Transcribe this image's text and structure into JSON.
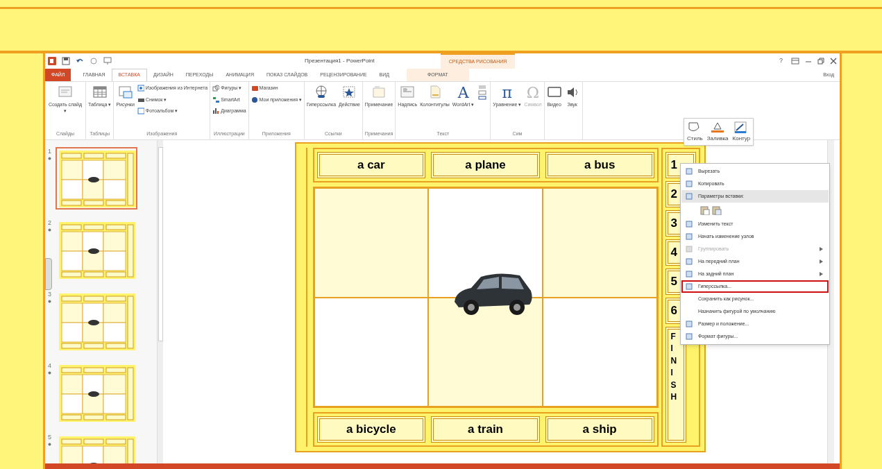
{
  "window": {
    "title": "Презентация1 - PowerPoint",
    "context_group": "СРЕДСТВА РИСОВАНИЯ",
    "help": "?",
    "sign_in": "Вход"
  },
  "tabs": [
    {
      "label": "ФАЙЛ",
      "kind": "file",
      "selected": false
    },
    {
      "label": "ГЛАВНАЯ",
      "kind": "tab",
      "selected": false
    },
    {
      "label": "ВСТАВКА",
      "kind": "tab",
      "selected": true
    },
    {
      "label": "ДИЗАЙН",
      "kind": "tab",
      "selected": false
    },
    {
      "label": "ПЕРЕХОДЫ",
      "kind": "tab",
      "selected": false
    },
    {
      "label": "АНИМАЦИЯ",
      "kind": "tab",
      "selected": false
    },
    {
      "label": "ПОКАЗ СЛАЙДОВ",
      "kind": "tab",
      "selected": false
    },
    {
      "label": "РЕЦЕНЗИРОВАНИЕ",
      "kind": "tab",
      "selected": false
    },
    {
      "label": "ВИД",
      "kind": "tab",
      "selected": false
    },
    {
      "label": "ФОРМАТ",
      "kind": "context",
      "selected": false
    }
  ],
  "ribbon_groups": [
    {
      "label": "Слайды",
      "items": [
        {
          "kind": "large",
          "label": "Создать слайд ▾",
          "disabled": false
        }
      ]
    },
    {
      "label": "Таблицы",
      "items": [
        {
          "kind": "large",
          "label": "Таблица ▾",
          "disabled": false
        }
      ]
    },
    {
      "label": "Изображения",
      "items": [
        {
          "kind": "large",
          "label": "Рисунки",
          "disabled": false
        },
        {
          "kind": "small",
          "label": "Изображения из Интернета",
          "disabled": false
        },
        {
          "kind": "small",
          "label": "Снимок ▾",
          "disabled": false
        },
        {
          "kind": "small",
          "label": "Фотоальбом ▾",
          "disabled": false
        }
      ]
    },
    {
      "label": "Иллюстрации",
      "items": [
        {
          "kind": "small",
          "label": "Фигуры ▾",
          "disabled": false
        },
        {
          "kind": "small",
          "label": "SmartArt",
          "disabled": false
        },
        {
          "kind": "small",
          "label": "Диаграмма",
          "disabled": false
        }
      ]
    },
    {
      "label": "Приложения",
      "items": [
        {
          "kind": "small",
          "label": "Магазин",
          "disabled": false
        },
        {
          "kind": "small",
          "label": "Мои приложения ▾",
          "disabled": false
        }
      ]
    },
    {
      "label": "Ссылки",
      "items": [
        {
          "kind": "large",
          "label": "Гиперссылка",
          "disabled": false
        },
        {
          "kind": "large",
          "label": "Действие",
          "disabled": false
        }
      ]
    },
    {
      "label": "Примечания",
      "items": [
        {
          "kind": "large",
          "label": "Примечание",
          "disabled": false
        }
      ]
    },
    {
      "label": "Текст",
      "items": [
        {
          "kind": "large",
          "label": "Надпись",
          "disabled": false
        },
        {
          "kind": "large",
          "label": "Колонтитулы",
          "disabled": false
        },
        {
          "kind": "large",
          "label": "WordArt ▾",
          "glyph": "A",
          "disabled": false
        },
        {
          "kind": "icons"
        }
      ]
    },
    {
      "label": "Сим",
      "items": [
        {
          "kind": "large",
          "label": "Уравнение ▾",
          "glyph": "π",
          "disabled": false
        },
        {
          "kind": "large",
          "label": "Символ",
          "glyph": "Ω",
          "disabled": true
        }
      ]
    },
    {
      "items": [
        {
          "kind": "large",
          "label": "Видео",
          "disabled": false
        },
        {
          "kind": "large",
          "label": "Звук",
          "disabled": false
        }
      ]
    }
  ],
  "thumbnails": [
    {
      "number": "1",
      "selected": true
    },
    {
      "number": "2",
      "selected": false
    },
    {
      "number": "3",
      "selected": false
    },
    {
      "number": "4",
      "selected": false
    },
    {
      "number": "5",
      "selected": false
    }
  ],
  "slide": {
    "top_labels": [
      "a car",
      "a plane",
      "a bus"
    ],
    "bottom_labels": [
      "a bicycle",
      "a train",
      "a ship"
    ],
    "steps": [
      "1",
      "2",
      "3",
      "4",
      "5",
      "6"
    ],
    "finish": "FINISH"
  },
  "mini_toolbar": [
    {
      "label": "Стиль"
    },
    {
      "label": "Заливка"
    },
    {
      "label": "Контур"
    }
  ],
  "context_menu": [
    {
      "kind": "item",
      "label": "Вырезать",
      "disabled": false,
      "highlighted": false,
      "submenu": false,
      "outlined": false
    },
    {
      "kind": "item",
      "label": "Копировать",
      "disabled": false,
      "highlighted": false,
      "submenu": false,
      "outlined": false
    },
    {
      "kind": "item",
      "label": "Параметры вставки:",
      "disabled": false,
      "highlighted": true,
      "submenu": false,
      "outlined": false
    },
    {
      "kind": "paste"
    },
    {
      "kind": "item",
      "label": "Изменить текст",
      "disabled": false,
      "highlighted": false,
      "submenu": false,
      "outlined": false
    },
    {
      "kind": "item",
      "label": "Начать изменение узлов",
      "disabled": false,
      "highlighted": false,
      "submenu": false,
      "outlined": false
    },
    {
      "kind": "item",
      "label": "Группировать",
      "disabled": true,
      "highlighted": false,
      "submenu": true,
      "outlined": false
    },
    {
      "kind": "item",
      "label": "На передний план",
      "disabled": false,
      "highlighted": false,
      "submenu": true,
      "outlined": false
    },
    {
      "kind": "item",
      "label": "На задний план",
      "disabled": false,
      "highlighted": false,
      "submenu": true,
      "outlined": false
    },
    {
      "kind": "item",
      "label": "Гиперссылка...",
      "disabled": false,
      "highlighted": false,
      "submenu": false,
      "outlined": true
    },
    {
      "kind": "item",
      "label": "Сохранить как рисунок...",
      "disabled": false,
      "highlighted": false,
      "submenu": false,
      "outlined": false
    },
    {
      "kind": "item",
      "label": "Назначить фигурой по умолчанию",
      "disabled": false,
      "highlighted": false,
      "submenu": false,
      "outlined": false
    },
    {
      "kind": "item",
      "label": "Размер и положение...",
      "disabled": false,
      "highlighted": false,
      "submenu": false,
      "outlined": false
    },
    {
      "kind": "item",
      "label": "Формат фигуры...",
      "disabled": false,
      "highlighted": false,
      "submenu": false,
      "outlined": false
    }
  ]
}
